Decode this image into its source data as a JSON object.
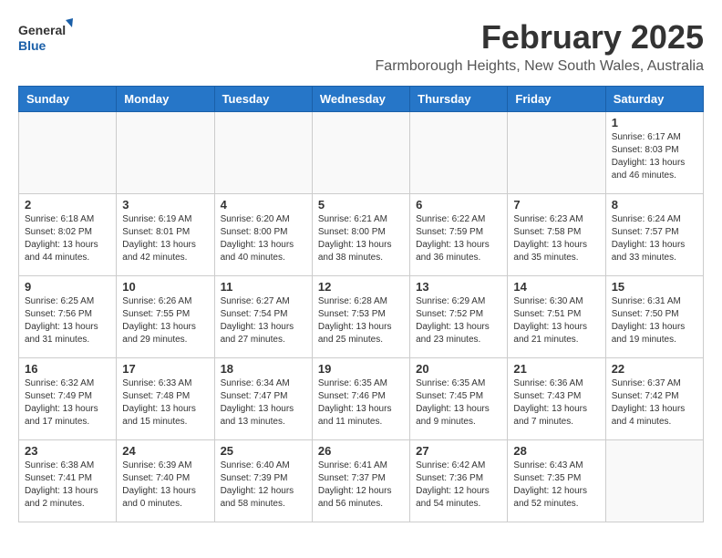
{
  "header": {
    "logo_general": "General",
    "logo_blue": "Blue",
    "month_title": "February 2025",
    "location": "Farmborough Heights, New South Wales, Australia"
  },
  "weekdays": [
    "Sunday",
    "Monday",
    "Tuesday",
    "Wednesday",
    "Thursday",
    "Friday",
    "Saturday"
  ],
  "weeks": [
    [
      {
        "day": "",
        "info": ""
      },
      {
        "day": "",
        "info": ""
      },
      {
        "day": "",
        "info": ""
      },
      {
        "day": "",
        "info": ""
      },
      {
        "day": "",
        "info": ""
      },
      {
        "day": "",
        "info": ""
      },
      {
        "day": "1",
        "info": "Sunrise: 6:17 AM\nSunset: 8:03 PM\nDaylight: 13 hours\nand 46 minutes."
      }
    ],
    [
      {
        "day": "2",
        "info": "Sunrise: 6:18 AM\nSunset: 8:02 PM\nDaylight: 13 hours\nand 44 minutes."
      },
      {
        "day": "3",
        "info": "Sunrise: 6:19 AM\nSunset: 8:01 PM\nDaylight: 13 hours\nand 42 minutes."
      },
      {
        "day": "4",
        "info": "Sunrise: 6:20 AM\nSunset: 8:00 PM\nDaylight: 13 hours\nand 40 minutes."
      },
      {
        "day": "5",
        "info": "Sunrise: 6:21 AM\nSunset: 8:00 PM\nDaylight: 13 hours\nand 38 minutes."
      },
      {
        "day": "6",
        "info": "Sunrise: 6:22 AM\nSunset: 7:59 PM\nDaylight: 13 hours\nand 36 minutes."
      },
      {
        "day": "7",
        "info": "Sunrise: 6:23 AM\nSunset: 7:58 PM\nDaylight: 13 hours\nand 35 minutes."
      },
      {
        "day": "8",
        "info": "Sunrise: 6:24 AM\nSunset: 7:57 PM\nDaylight: 13 hours\nand 33 minutes."
      }
    ],
    [
      {
        "day": "9",
        "info": "Sunrise: 6:25 AM\nSunset: 7:56 PM\nDaylight: 13 hours\nand 31 minutes."
      },
      {
        "day": "10",
        "info": "Sunrise: 6:26 AM\nSunset: 7:55 PM\nDaylight: 13 hours\nand 29 minutes."
      },
      {
        "day": "11",
        "info": "Sunrise: 6:27 AM\nSunset: 7:54 PM\nDaylight: 13 hours\nand 27 minutes."
      },
      {
        "day": "12",
        "info": "Sunrise: 6:28 AM\nSunset: 7:53 PM\nDaylight: 13 hours\nand 25 minutes."
      },
      {
        "day": "13",
        "info": "Sunrise: 6:29 AM\nSunset: 7:52 PM\nDaylight: 13 hours\nand 23 minutes."
      },
      {
        "day": "14",
        "info": "Sunrise: 6:30 AM\nSunset: 7:51 PM\nDaylight: 13 hours\nand 21 minutes."
      },
      {
        "day": "15",
        "info": "Sunrise: 6:31 AM\nSunset: 7:50 PM\nDaylight: 13 hours\nand 19 minutes."
      }
    ],
    [
      {
        "day": "16",
        "info": "Sunrise: 6:32 AM\nSunset: 7:49 PM\nDaylight: 13 hours\nand 17 minutes."
      },
      {
        "day": "17",
        "info": "Sunrise: 6:33 AM\nSunset: 7:48 PM\nDaylight: 13 hours\nand 15 minutes."
      },
      {
        "day": "18",
        "info": "Sunrise: 6:34 AM\nSunset: 7:47 PM\nDaylight: 13 hours\nand 13 minutes."
      },
      {
        "day": "19",
        "info": "Sunrise: 6:35 AM\nSunset: 7:46 PM\nDaylight: 13 hours\nand 11 minutes."
      },
      {
        "day": "20",
        "info": "Sunrise: 6:35 AM\nSunset: 7:45 PM\nDaylight: 13 hours\nand 9 minutes."
      },
      {
        "day": "21",
        "info": "Sunrise: 6:36 AM\nSunset: 7:43 PM\nDaylight: 13 hours\nand 7 minutes."
      },
      {
        "day": "22",
        "info": "Sunrise: 6:37 AM\nSunset: 7:42 PM\nDaylight: 13 hours\nand 4 minutes."
      }
    ],
    [
      {
        "day": "23",
        "info": "Sunrise: 6:38 AM\nSunset: 7:41 PM\nDaylight: 13 hours\nand 2 minutes."
      },
      {
        "day": "24",
        "info": "Sunrise: 6:39 AM\nSunset: 7:40 PM\nDaylight: 13 hours\nand 0 minutes."
      },
      {
        "day": "25",
        "info": "Sunrise: 6:40 AM\nSunset: 7:39 PM\nDaylight: 12 hours\nand 58 minutes."
      },
      {
        "day": "26",
        "info": "Sunrise: 6:41 AM\nSunset: 7:37 PM\nDaylight: 12 hours\nand 56 minutes."
      },
      {
        "day": "27",
        "info": "Sunrise: 6:42 AM\nSunset: 7:36 PM\nDaylight: 12 hours\nand 54 minutes."
      },
      {
        "day": "28",
        "info": "Sunrise: 6:43 AM\nSunset: 7:35 PM\nDaylight: 12 hours\nand 52 minutes."
      },
      {
        "day": "",
        "info": ""
      }
    ]
  ]
}
